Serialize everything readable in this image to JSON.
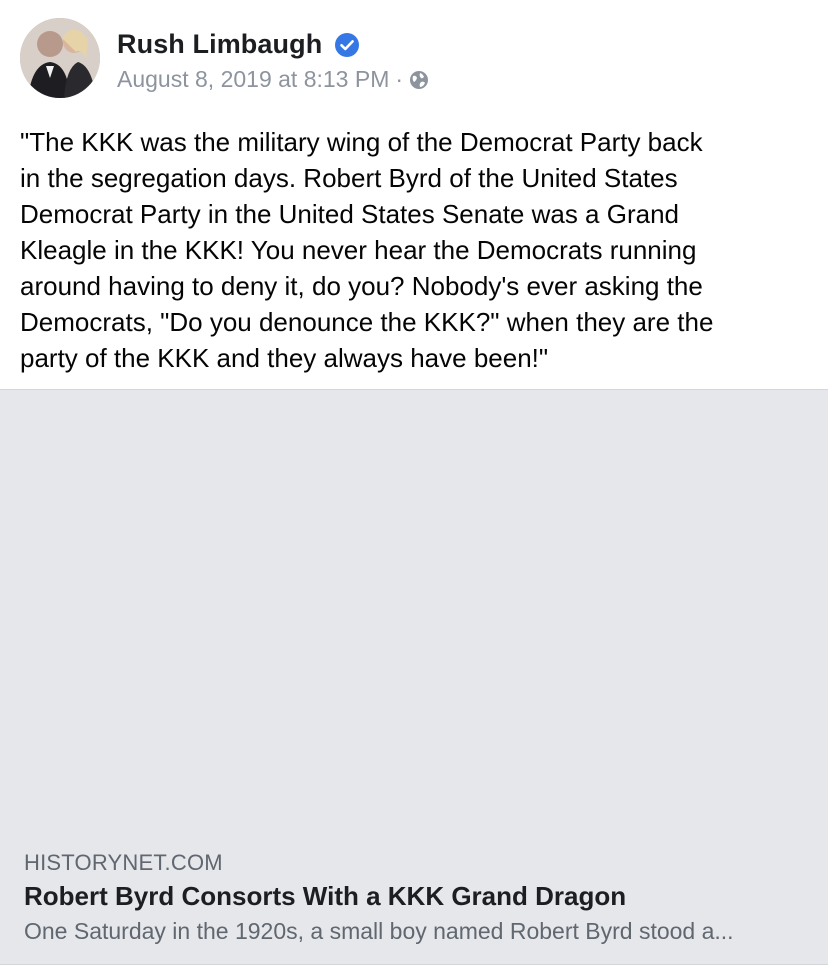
{
  "post": {
    "author": "Rush Limbaugh",
    "timestamp": "August 8, 2019 at 8:13 PM",
    "separator": "·",
    "privacy_icon": "globe-icon",
    "verified_icon": "verified-badge-icon",
    "text": "\"The KKK was the military wing of the Democrat Party back\nin the segregation days. Robert Byrd of the United States\nDemocrat Party in the United States Senate was a Grand\nKleagle in the KKK! You never hear the Democrats running\naround having to deny it, do you? Nobody's ever asking the\nDemocrats, \"Do you denounce the KKK?\" when they are the\nparty of the KKK and they always have been!\""
  },
  "link_preview": {
    "domain": "HISTORYNET.COM",
    "title": "Robert Byrd Consorts With a KKK Grand Dragon",
    "description": "One Saturday in the 1920s, a small boy named Robert Byrd stood a..."
  },
  "colors": {
    "verified": "#3578e5",
    "meta_text": "#8d949e",
    "preview_bg": "#e6e7eb"
  }
}
